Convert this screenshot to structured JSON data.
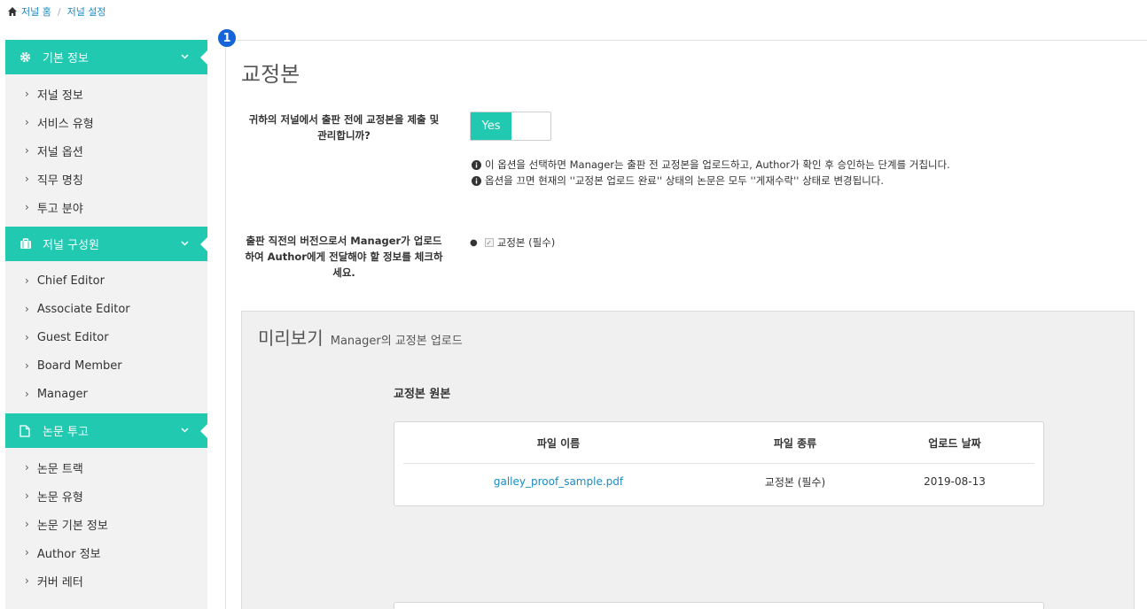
{
  "breadcrumb": {
    "home": "저널 홈",
    "separator": "/",
    "current": "저널 설정"
  },
  "sidebar": {
    "sections": [
      {
        "title": "기본 정보",
        "icon": "gear-icon",
        "items": [
          "저널 정보",
          "서비스 유형",
          "저널 옵션",
          "직무 명칭",
          "투고 분야"
        ]
      },
      {
        "title": "저널 구성원",
        "icon": "briefcase-icon",
        "items": [
          "Chief Editor",
          "Associate Editor",
          "Guest Editor",
          "Board Member",
          "Manager"
        ]
      },
      {
        "title": "논문 투고",
        "icon": "document-icon",
        "items": [
          "논문 트랙",
          "논문 유형",
          "논문 기본 정보",
          "Author 정보",
          "커버 레터"
        ]
      }
    ]
  },
  "step_badge": "1",
  "main": {
    "title": "교정본",
    "question1": {
      "line1": "귀하의 저널에서 출판 전에 교정본을 제출 및",
      "line2": "관리합니까?"
    },
    "toggle": {
      "label": "Yes",
      "state": "on"
    },
    "info": [
      "이 옵션을 선택하면 Manager는 출판 전 교정본을 업로드하고, Author가 확인 후 승인하는 단계를 거칩니다.",
      "옵션을 끄면 현재의 ''교정본 업로드 완료'' 상태의 논문은 모두 ''게재수락'' 상태로 변경됩니다."
    ],
    "question2": {
      "line1": "출판 직전의 버전으로서 Manager가 업로드",
      "line2": "하여 Author에게 전달해야 할 정보를 체크하",
      "line3": "세요."
    },
    "checklist": [
      {
        "label": "교정본 (필수)",
        "checked": true
      }
    ],
    "preview": {
      "title": "미리보기",
      "subtitle": "Manager의 교정본 업로드",
      "section_title": "교정본 원본",
      "table": {
        "headers": [
          "파일 이름",
          "파일 종류",
          "업로드 날짜"
        ],
        "rows": [
          {
            "file_name": "galley_proof_sample.pdf",
            "file_type": "교정본 (필수)",
            "upload_date": "2019-08-13"
          }
        ]
      }
    }
  },
  "colors": {
    "accent": "#20c9b0",
    "link": "#1a8bc4",
    "badge": "#1565d8",
    "sidebar_bg": "#f2f2f2"
  }
}
